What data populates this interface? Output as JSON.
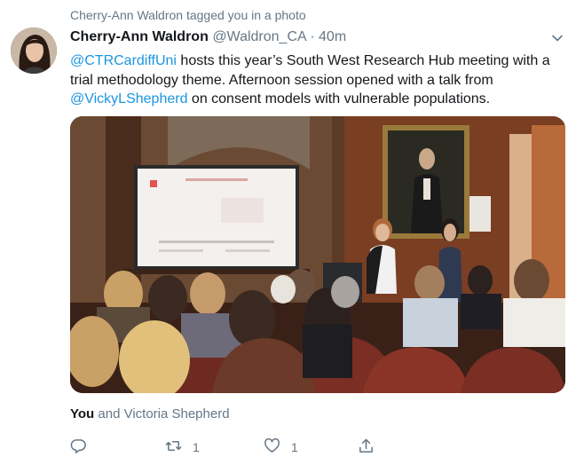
{
  "social_context": "Cherry-Ann Waldron tagged you in a photo",
  "tweet": {
    "author_name": "Cherry-Ann Waldron",
    "author_handle": "@Waldron_CA",
    "separator": "·",
    "time": "40m",
    "text": {
      "mention1": "@CTRCardiffUni",
      "part1": " hosts this year’s South West Research Hub meeting with a trial methodology theme. Afternoon session opened with a talk from ",
      "mention2": "@VickyLShepherd",
      "part2": " on consent models with vulnerable populations."
    }
  },
  "liked_by": {
    "you": "You",
    "rest": " and Victoria Shepherd"
  },
  "actions": {
    "reply": {
      "icon": "reply-icon"
    },
    "retweet": {
      "icon": "retweet-icon",
      "count": "1"
    },
    "like": {
      "icon": "heart-icon",
      "count": "1"
    },
    "share": {
      "icon": "share-icon"
    }
  },
  "colors": {
    "accent": "#1b95e0",
    "muted": "#657786",
    "text": "#14171a"
  }
}
